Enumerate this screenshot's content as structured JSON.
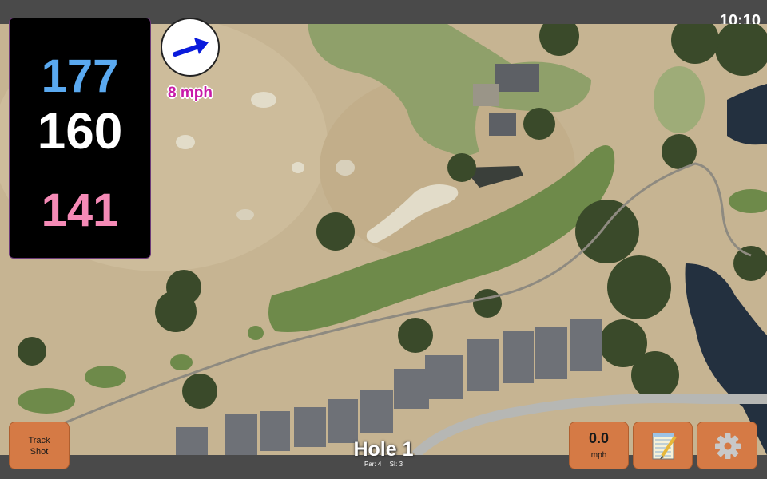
{
  "status_bar": {
    "time": "10:10"
  },
  "distances": {
    "back": "177",
    "center": "160",
    "front": "141"
  },
  "wind": {
    "speed": "8 mph",
    "icon": "arrow-icon",
    "color": "#0a1bdc"
  },
  "track_shot": {
    "label_line1": "Track",
    "label_line2": "Shot"
  },
  "hole": {
    "title": "Hole 1",
    "par": "Par: 4",
    "si": "SI: 3"
  },
  "speed": {
    "value": "0.0",
    "unit": "mph"
  },
  "icons": {
    "notes": "notepad-icon",
    "settings": "gear-icon"
  },
  "colors": {
    "back": "#5aa9f0",
    "center": "#ffffff",
    "front": "#f58ab6",
    "button": "#d57a45",
    "wind_text": "#c81ba8"
  }
}
